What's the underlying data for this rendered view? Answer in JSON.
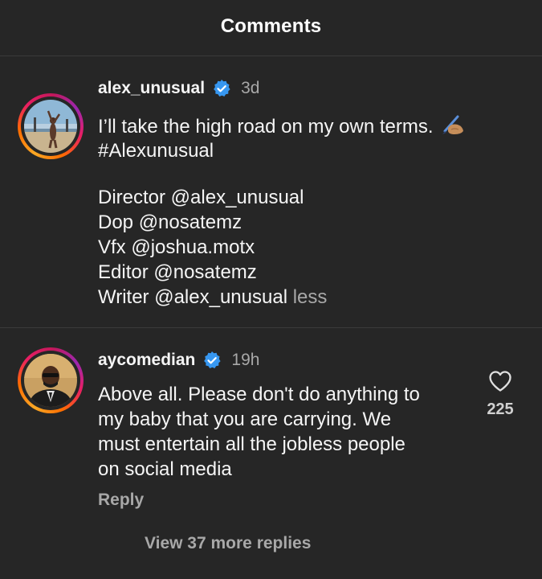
{
  "header": {
    "title": "Comments"
  },
  "caption": {
    "username": "alex_unusual",
    "time": "3d",
    "lines": [
      "I’ll take the high road on my own terms.",
      "#Alexunusual",
      "",
      "Director @alex_unusual",
      "Dop @nosatemz",
      "Vfx @joshua.motx",
      "Editor @nosatemz",
      "Writer @alex_unusual"
    ],
    "less_label": "less",
    "emoji_icon": "writing-hand-icon"
  },
  "comment": {
    "username": "aycomedian",
    "time": "19h",
    "lines": [
      "Above all. Please don't do anything to",
      "my baby that you are carrying. We",
      "must entertain all the jobless people",
      "on social media"
    ],
    "likes": "225",
    "reply_label": "Reply",
    "view_replies_label": "View 37 more replies"
  },
  "colors": {
    "background": "#262626",
    "verified": "#3797f0",
    "muted": "#a8a8a8"
  }
}
